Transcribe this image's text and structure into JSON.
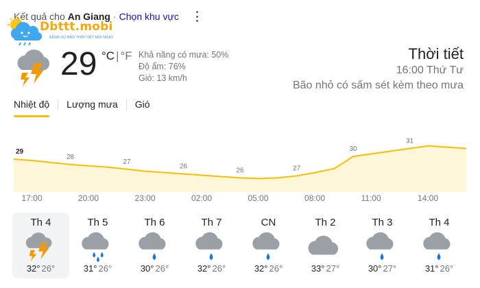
{
  "header": {
    "prefix": "Kết quả cho",
    "location": "An Giang",
    "separator": "·",
    "change_location": "Chọn khu vực"
  },
  "logo": {
    "brand": "Dbttt.mobi",
    "tagline": "KÊNH DỰ BÁO THỜI TIẾT MỖI NGÀY"
  },
  "current": {
    "icon": "thunderstorm-icon",
    "temperature": "29",
    "unit_c": "°C",
    "unit_sep": "|",
    "unit_f": "°F",
    "precip": "Khả năng có mưa: 50%",
    "humidity": "Độ ẩm: 76%",
    "wind": "Gió: 13 km/h"
  },
  "summary": {
    "title": "Thời tiết",
    "time": "16:00 Thứ Tư",
    "condition": "Bão nhỏ có sấm sét kèm theo mưa"
  },
  "tabs": [
    {
      "label": "Nhiệt độ",
      "active": true
    },
    {
      "label": "Lượng mưa",
      "active": false
    },
    {
      "label": "Gió",
      "active": false
    }
  ],
  "chart_data": {
    "type": "area",
    "x": [
      "16:00",
      "17:00",
      "18:00",
      "19:00",
      "20:00",
      "21:00",
      "22:00",
      "23:00",
      "00:00",
      "01:00",
      "02:00",
      "03:00",
      "04:00",
      "05:00",
      "06:00",
      "07:00",
      "08:00",
      "09:00",
      "10:00",
      "11:00",
      "12:00",
      "13:00",
      "14:00",
      "15:00",
      "16:00"
    ],
    "values": [
      29,
      28.8,
      28.5,
      28.2,
      28,
      27.8,
      27.5,
      27.2,
      27,
      26.8,
      26.6,
      26.4,
      26.2,
      26.1,
      26.2,
      26.5,
      27,
      27.6,
      29.4,
      29.8,
      30.2,
      30.6,
      31,
      30.8,
      30.6
    ],
    "labels": [
      {
        "index": 0,
        "text": "29"
      },
      {
        "index": 3,
        "text": "28"
      },
      {
        "index": 6,
        "text": "27"
      },
      {
        "index": 9,
        "text": "26"
      },
      {
        "index": 12,
        "text": "26"
      },
      {
        "index": 15,
        "text": "27"
      },
      {
        "index": 18,
        "text": "30"
      },
      {
        "index": 21,
        "text": "31"
      }
    ],
    "tick_labels": [
      "17:00",
      "20:00",
      "23:00",
      "02:00",
      "05:00",
      "08:00",
      "11:00",
      "14:00"
    ],
    "line_color": "#fbbc04",
    "fill_color": "#fef7d7"
  },
  "days": [
    {
      "name": "Th 4",
      "icon": "thunderstorm-icon",
      "high": "32°",
      "low": "26°",
      "selected": true
    },
    {
      "name": "Th 5",
      "icon": "heavy-rain-icon",
      "high": "31°",
      "low": "26°",
      "selected": false
    },
    {
      "name": "Th 6",
      "icon": "rain-icon",
      "high": "30°",
      "low": "26°",
      "selected": false
    },
    {
      "name": "Th 7",
      "icon": "rain-icon",
      "high": "32°",
      "low": "26°",
      "selected": false
    },
    {
      "name": "CN",
      "icon": "rain-icon",
      "high": "32°",
      "low": "26°",
      "selected": false
    },
    {
      "name": "Th 2",
      "icon": "cloudy-icon",
      "high": "33°",
      "low": "27°",
      "selected": false
    },
    {
      "name": "Th 3",
      "icon": "rain-icon",
      "high": "30°",
      "low": "27°",
      "selected": false
    },
    {
      "name": "Th 4",
      "icon": "rain-icon",
      "high": "31°",
      "low": "26°",
      "selected": false
    }
  ],
  "colors": {
    "accent": "#fbbc04",
    "link": "#1a0dab",
    "cloud": "#9aa0a6",
    "rain": "#1a73e8",
    "bolt": "#f29900"
  }
}
